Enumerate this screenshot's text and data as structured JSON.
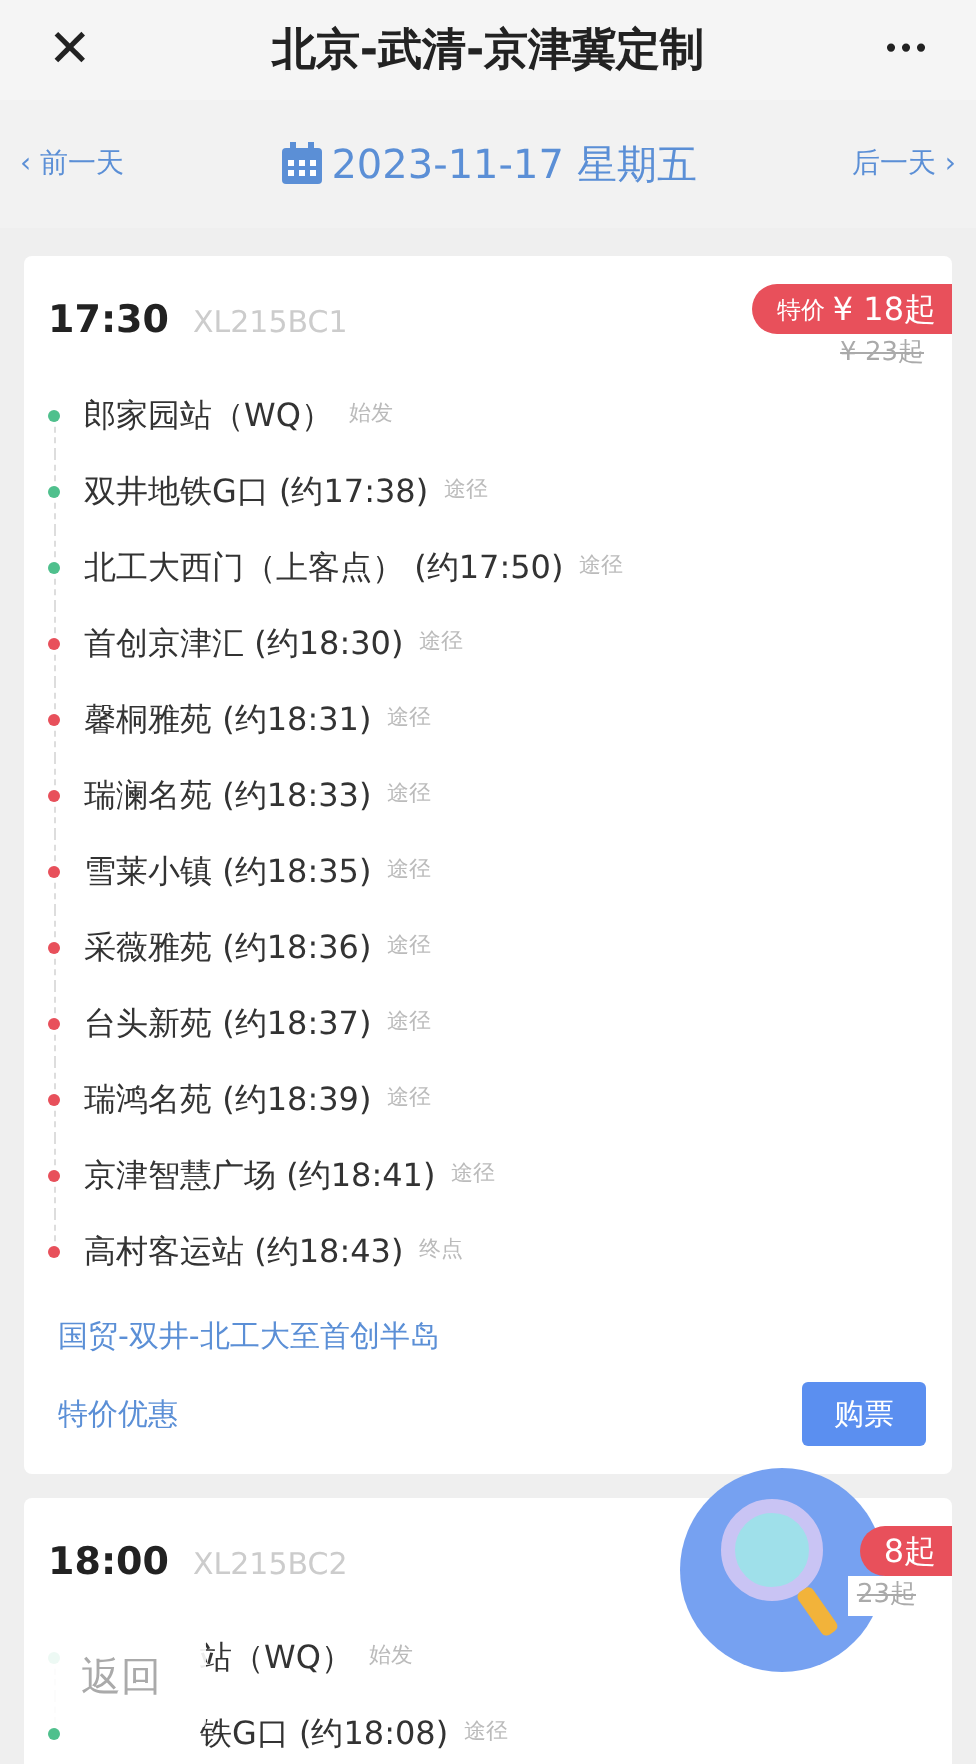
{
  "header": {
    "close": "✕",
    "title": "北京-武清-京津冀定制",
    "more": "•••"
  },
  "date_bar": {
    "prev": "‹ 前一天",
    "date": "2023-11-17 星期五",
    "next": "后一天 ›"
  },
  "trips": [
    {
      "time": "17:30",
      "code": "XL215BC1",
      "price_tag": "特价",
      "price": "¥ 18起",
      "original_price": "¥ 23起",
      "stops": [
        {
          "name": "郎家园站（WQ）",
          "tag": "始发",
          "kind": "board"
        },
        {
          "name": "双井地铁G口 (约17:38)",
          "tag": "途径",
          "kind": "board"
        },
        {
          "name": "北工大西门（上客点） (约17:50)",
          "tag": "途径",
          "kind": "board"
        },
        {
          "name": "首创京津汇 (约18:30)",
          "tag": "途径",
          "kind": "alight"
        },
        {
          "name": "馨桐雅苑 (约18:31)",
          "tag": "途径",
          "kind": "alight"
        },
        {
          "name": "瑞澜名苑 (约18:33)",
          "tag": "途径",
          "kind": "alight"
        },
        {
          "name": "雪莱小镇 (约18:35)",
          "tag": "途径",
          "kind": "alight"
        },
        {
          "name": "采薇雅苑 (约18:36)",
          "tag": "途径",
          "kind": "alight"
        },
        {
          "name": "台头新苑 (约18:37)",
          "tag": "途径",
          "kind": "alight"
        },
        {
          "name": "瑞鸿名苑 (约18:39)",
          "tag": "途径",
          "kind": "alight"
        },
        {
          "name": "京津智慧广场 (约18:41)",
          "tag": "途径",
          "kind": "alight"
        },
        {
          "name": "高村客运站 (约18:43)",
          "tag": "终点",
          "kind": "alight"
        }
      ],
      "route": "国贸-双井-北工大至首创半岛",
      "promo": "特价优惠",
      "buy": "购票"
    },
    {
      "time": "18:00",
      "code": "XL215BC2",
      "price": "8起",
      "original_price": "23起",
      "stops": [
        {
          "name": "站（WQ）",
          "tag": "始发",
          "kind": "board"
        },
        {
          "name": "铁G口 (约18:08)",
          "tag": "途径",
          "kind": "board"
        }
      ]
    }
  ],
  "back_button": "返回"
}
